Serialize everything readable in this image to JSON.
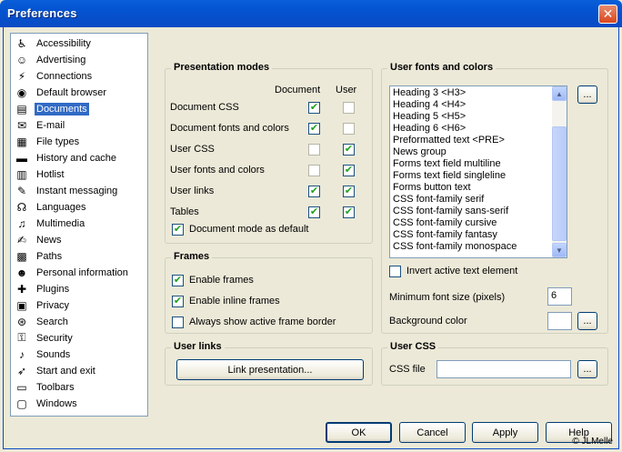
{
  "window": {
    "title": "Preferences"
  },
  "sidebar": {
    "items": [
      {
        "label": "Accessibility",
        "icon": "♿",
        "name": "accessibility-icon"
      },
      {
        "label": "Advertising",
        "icon": "☺",
        "name": "smiley-icon"
      },
      {
        "label": "Connections",
        "icon": "⚡",
        "name": "plug-icon"
      },
      {
        "label": "Default browser",
        "icon": "◉",
        "name": "browser-icon"
      },
      {
        "label": "Documents",
        "icon": "▤",
        "name": "document-icon"
      },
      {
        "label": "E-mail",
        "icon": "✉",
        "name": "envelope-icon"
      },
      {
        "label": "File types",
        "icon": "▦",
        "name": "file-types-icon"
      },
      {
        "label": "History and cache",
        "icon": "▬",
        "name": "history-icon"
      },
      {
        "label": "Hotlist",
        "icon": "▥",
        "name": "hotlist-icon"
      },
      {
        "label": "Instant messaging",
        "icon": "✎",
        "name": "messaging-icon"
      },
      {
        "label": "Languages",
        "icon": "☊",
        "name": "languages-icon"
      },
      {
        "label": "Multimedia",
        "icon": "♫",
        "name": "multimedia-icon"
      },
      {
        "label": "News",
        "icon": "✍",
        "name": "news-icon"
      },
      {
        "label": "Paths",
        "icon": "▩",
        "name": "paths-icon"
      },
      {
        "label": "Personal information",
        "icon": "☻",
        "name": "person-icon"
      },
      {
        "label": "Plugins",
        "icon": "✚",
        "name": "plugins-icon"
      },
      {
        "label": "Privacy",
        "icon": "▣",
        "name": "privacy-icon"
      },
      {
        "label": "Search",
        "icon": "⊛",
        "name": "search-icon"
      },
      {
        "label": "Security",
        "icon": "⚿",
        "name": "key-icon"
      },
      {
        "label": "Sounds",
        "icon": "♪",
        "name": "sounds-icon"
      },
      {
        "label": "Start and exit",
        "icon": "➶",
        "name": "start-exit-icon"
      },
      {
        "label": "Toolbars",
        "icon": "▭",
        "name": "toolbars-icon"
      },
      {
        "label": "Windows",
        "icon": "▢",
        "name": "windows-icon"
      }
    ],
    "selected": "Documents"
  },
  "presentation": {
    "title": "Presentation modes",
    "col_document": "Document",
    "col_user": "User",
    "rows": [
      {
        "label": "Document CSS",
        "doc": "checked",
        "user": "disabled"
      },
      {
        "label": "Document fonts and colors",
        "doc": "checked",
        "user": "disabled"
      },
      {
        "label": "User CSS",
        "doc": "disabled",
        "user": "checked"
      },
      {
        "label": "User fonts and colors",
        "doc": "disabled",
        "user": "checked"
      },
      {
        "label": "User links",
        "doc": "checked",
        "user": "checked"
      },
      {
        "label": "Tables",
        "doc": "checked",
        "user": "checked"
      }
    ],
    "default_label": "Document mode as default",
    "default_checked": true
  },
  "frames": {
    "title": "Frames",
    "items": [
      {
        "label": "Enable frames",
        "checked": true
      },
      {
        "label": "Enable inline frames",
        "checked": true
      },
      {
        "label": "Always show active frame border",
        "checked": false
      }
    ]
  },
  "user_links": {
    "title": "User links",
    "button": "Link presentation..."
  },
  "fonts": {
    "title": "User fonts and colors",
    "items": [
      "Heading 3 <H3>",
      "Heading 4 <H4>",
      "Heading 5 <H5>",
      "Heading 6 <H6>",
      "Preformatted text <PRE>",
      "News group",
      "Forms text field multiline",
      "Forms text field singleline",
      "Forms button text",
      "CSS font-family serif",
      "CSS font-family sans-serif",
      "CSS font-family cursive",
      "CSS font-family fantasy",
      "CSS font-family monospace"
    ],
    "edit_button": "...",
    "invert_label": "Invert active text element",
    "invert_checked": false,
    "min_font_label": "Minimum font size (pixels)",
    "min_font_value": "6",
    "bg_color_label": "Background color",
    "bg_button": "..."
  },
  "user_css": {
    "title": "User CSS",
    "file_label": "CSS file",
    "file_value": "",
    "browse_button": "..."
  },
  "buttons": {
    "ok": "OK",
    "cancel": "Cancel",
    "apply": "Apply",
    "help": "Help"
  },
  "copyright": "© JLMelle",
  "check_glyph": "✔"
}
